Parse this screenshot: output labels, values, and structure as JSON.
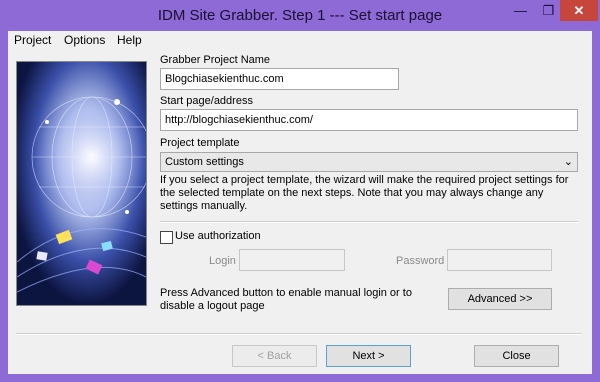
{
  "window": {
    "title": "IDM Site Grabber. Step 1 --- Set start page",
    "minimize_glyph": "—",
    "maximize_glyph": "❐",
    "close_glyph": "✕"
  },
  "menu": {
    "items": [
      "Project",
      "Options",
      "Help"
    ]
  },
  "form": {
    "project_name_label": "Grabber Project Name",
    "project_name_value": "Blogchiasekienthuc.com",
    "start_page_label": "Start page/address",
    "start_page_value": "http://blogchiasekienthuc.com/",
    "template_label": "Project template",
    "template_value": "Custom settings",
    "template_help": "If you select a project template, the wizard will make the required project settings for the selected template on the next steps. Note that you may always change any settings manually.",
    "use_auth_label": "Use authorization",
    "use_auth_checked": false,
    "login_label": "Login",
    "login_value": "",
    "password_label": "Password",
    "password_value": "",
    "advanced_help": "Press Advanced button to enable manual login or to disable a logout page",
    "advanced_button": "Advanced >>"
  },
  "footer": {
    "back_button": "< Back",
    "next_button": "Next >",
    "close_button": "Close"
  },
  "colors": {
    "titlebar": "#8d6ad6",
    "close_button": "#c7463b",
    "dialog_bg": "#f0f0f0"
  }
}
